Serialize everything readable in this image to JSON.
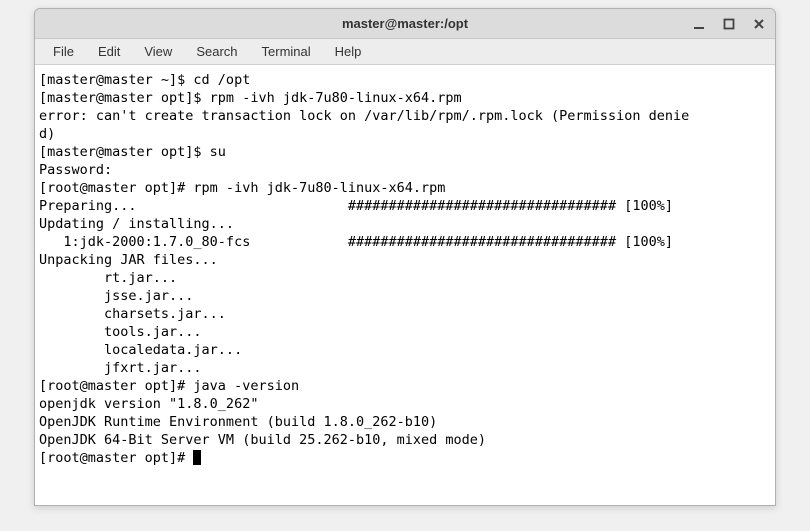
{
  "window": {
    "title": "master@master:/opt"
  },
  "menu": {
    "file": "File",
    "edit": "Edit",
    "view": "View",
    "search": "Search",
    "terminal": "Terminal",
    "help": "Help"
  },
  "lines": {
    "l0": "[master@master ~]$ cd /opt",
    "l1": "[master@master opt]$ rpm -ivh jdk-7u80-linux-x64.rpm",
    "l2": "error: can't create transaction lock on /var/lib/rpm/.rpm.lock (Permission denie",
    "l3": "d)",
    "l4": "[master@master opt]$ su",
    "l5": "Password:",
    "l6": "[root@master opt]# rpm -ivh jdk-7u80-linux-x64.rpm",
    "l7": "Preparing...                          ################################# [100%]",
    "l8": "Updating / installing...",
    "l9": "   1:jdk-2000:1.7.0_80-fcs            ################################# [100%]",
    "l10": "Unpacking JAR files...",
    "l11": "        rt.jar...",
    "l12": "        jsse.jar...",
    "l13": "        charsets.jar...",
    "l14": "        tools.jar...",
    "l15": "        localedata.jar...",
    "l16": "        jfxrt.jar...",
    "l17": "[root@master opt]# java -version",
    "l18": "openjdk version \"1.8.0_262\"",
    "l19": "OpenJDK Runtime Environment (build 1.8.0_262-b10)",
    "l20": "OpenJDK 64-Bit Server VM (build 25.262-b10, mixed mode)",
    "l21": "[root@master opt]# "
  }
}
